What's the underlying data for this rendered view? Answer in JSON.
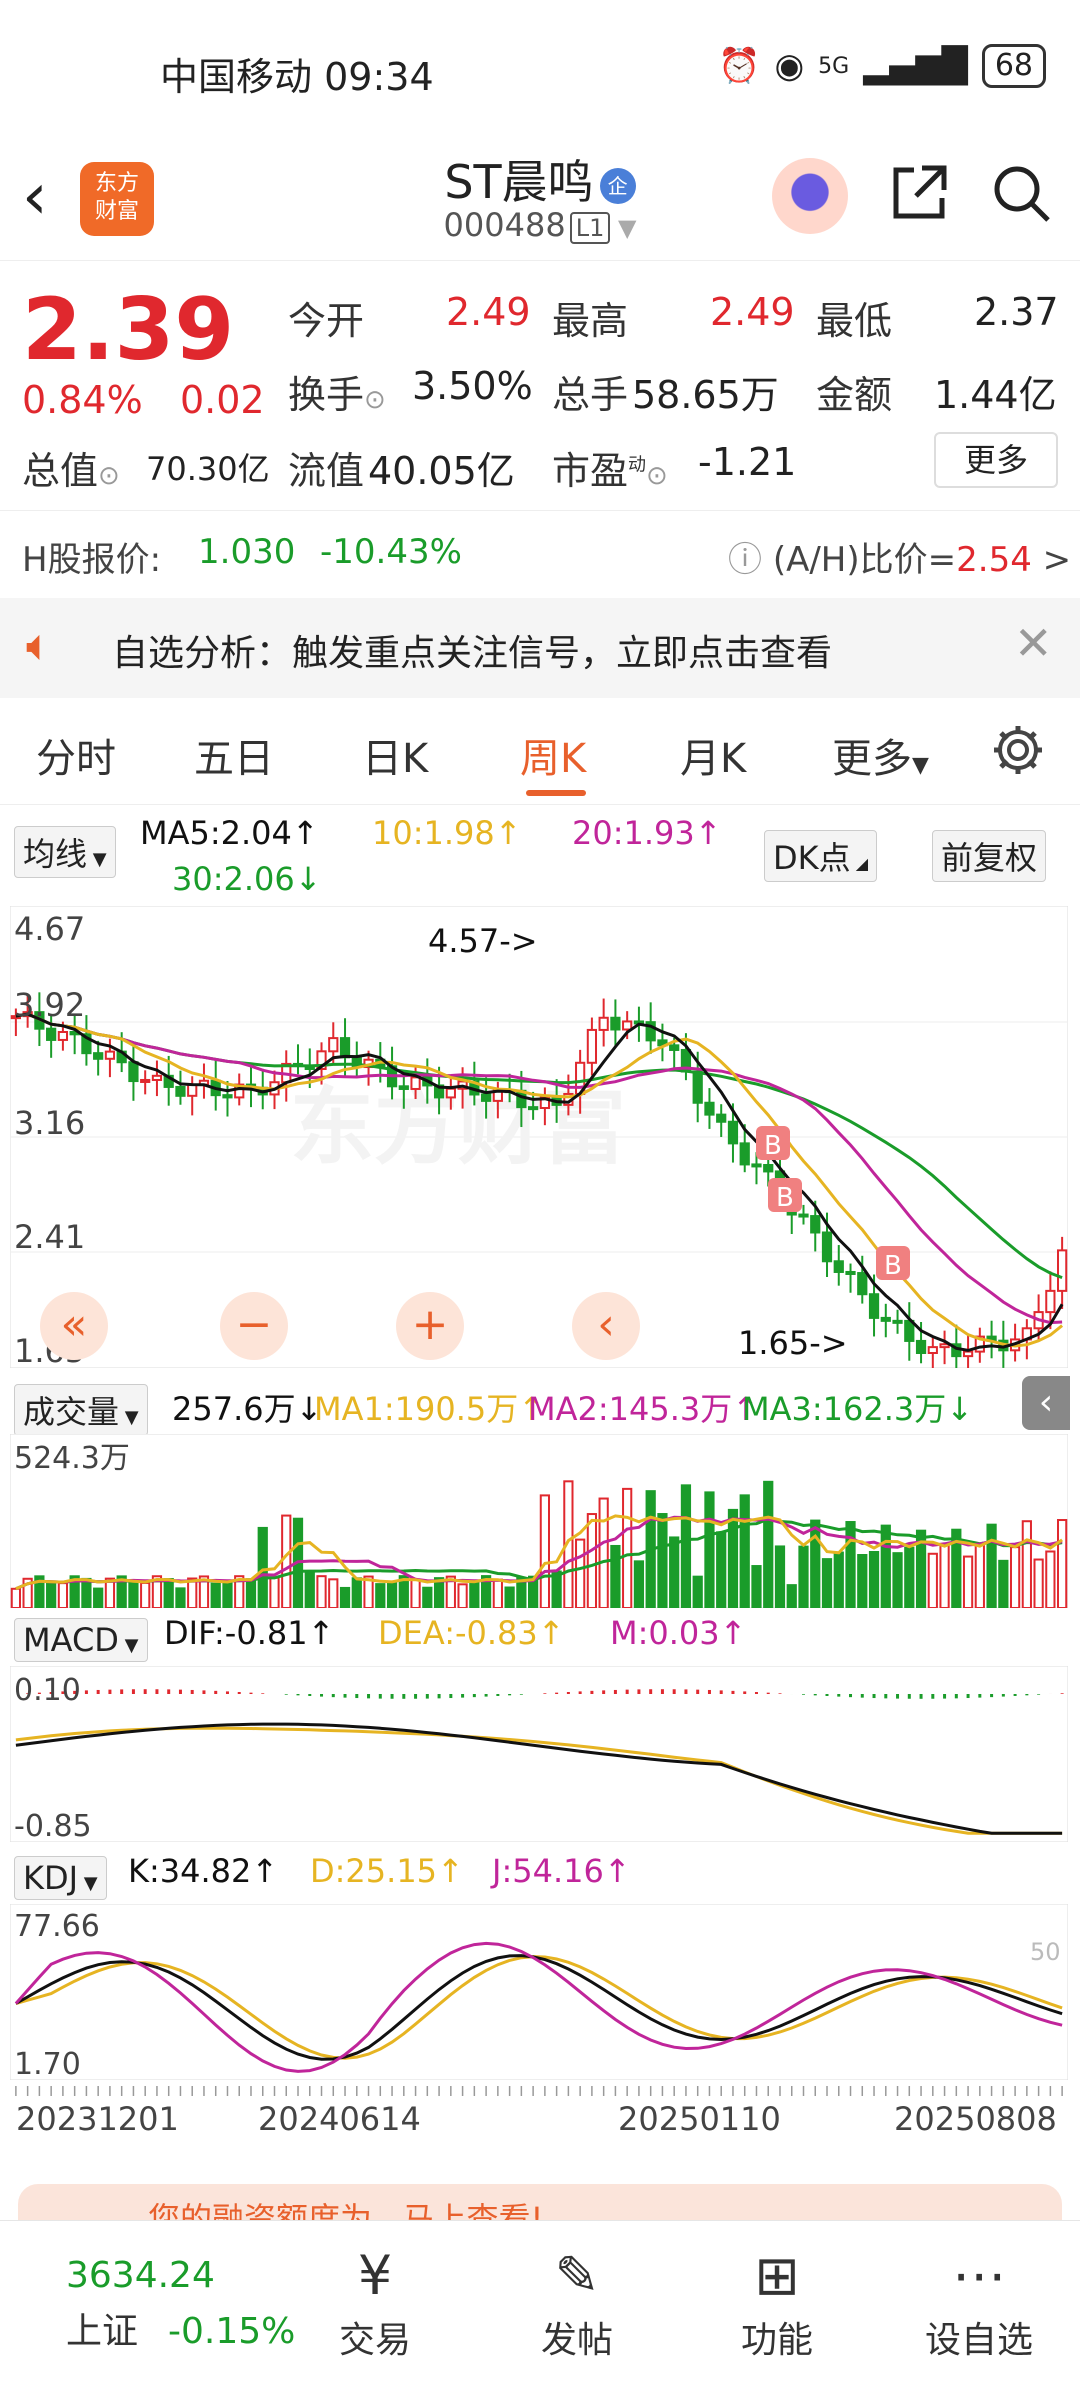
{
  "status_bar": {
    "carrier": "中国移动",
    "time": "09:34",
    "network": "5G",
    "battery": "68"
  },
  "header": {
    "logo_line1": "东方",
    "logo_line2": "财富",
    "title": "ST晨鸣",
    "enterprise_badge": "企",
    "code": "000488",
    "level": "L1"
  },
  "quote": {
    "price": "2.39",
    "change_pct": "0.84%",
    "change": "0.02",
    "open_label": "今开",
    "open": "2.49",
    "high_label": "最高",
    "high": "2.49",
    "low_label": "最低",
    "low": "2.37",
    "turnover_label": "换手",
    "turnover": "3.50%",
    "volume_label": "总手",
    "volume": "58.65万",
    "amount_label": "金额",
    "amount": "1.44亿",
    "mktcap_label": "总值",
    "mktcap": "70.30亿",
    "float_label": "流值",
    "float_cap": "40.05亿",
    "pe_label": "市盈",
    "pe_sup": "动",
    "pe": "-1.21",
    "more": "更多"
  },
  "h_share": {
    "label": "H股报价:",
    "price": "1.030",
    "change": "-10.43%",
    "ah_label": "(A/H)比价=",
    "ah_value": "2.54",
    "arrow": ">"
  },
  "notice": {
    "text": "自选分析：触发重点关注信号，立即点击查看"
  },
  "tabs": [
    "分时",
    "五日",
    "日K",
    "周K",
    "月K",
    "更多"
  ],
  "active_tab": "周K",
  "kline": {
    "ma_select": "均线",
    "ma5": "MA5:2.04↑",
    "ma10": "10:1.98↑",
    "ma20": "20:1.93↑",
    "ma30": "30:2.06↓",
    "dk_button": "DK点",
    "adjust_button": "前复权",
    "price_axis": [
      "4.67",
      "3.92",
      "3.16",
      "2.41",
      "1.65"
    ],
    "high_marker": "4.57->",
    "low_marker": "1.65->",
    "signal_label": "B"
  },
  "volume_panel": {
    "select": "成交量",
    "value": "257.6万↓",
    "ma1": "MA1:190.5万↑",
    "ma2": "MA2:145.3万↑",
    "ma3": "MA3:162.3万↓",
    "axis_top": "524.3万"
  },
  "macd_panel": {
    "select": "MACD",
    "dif": "DIF:-0.81↑",
    "dea": "DEA:-0.83↑",
    "m": "M:0.03↑",
    "axis_top": "0.10",
    "axis_bottom": "-0.85"
  },
  "kdj_panel": {
    "select": "KDJ",
    "k": "K:34.82↑",
    "d": "D:25.15↑",
    "j": "J:54.16↑",
    "axis_top": "77.66",
    "axis_bottom": "1.70",
    "right_label": "50"
  },
  "date_axis": [
    "20231201",
    "20240614",
    "20250110",
    "20250808"
  ],
  "promo": {
    "text": "您的融资额度为...马上查看!"
  },
  "bottom_nav": {
    "index_value": "3634.24",
    "index_name": "上证",
    "index_change": "-0.15%",
    "items": [
      {
        "label": "交易",
        "icon": "trade-icon"
      },
      {
        "label": "发帖",
        "icon": "post-icon"
      },
      {
        "label": "功能",
        "icon": "grid-icon"
      },
      {
        "label": "设自选",
        "icon": "more-icon"
      }
    ]
  },
  "colors": {
    "up": "#e0282e",
    "down": "#1a9c2a",
    "accent": "#e8602c",
    "ma5": "#000000",
    "ma10": "#e6b422",
    "ma20": "#c0259a",
    "ma30": "#1a9c2a"
  }
}
